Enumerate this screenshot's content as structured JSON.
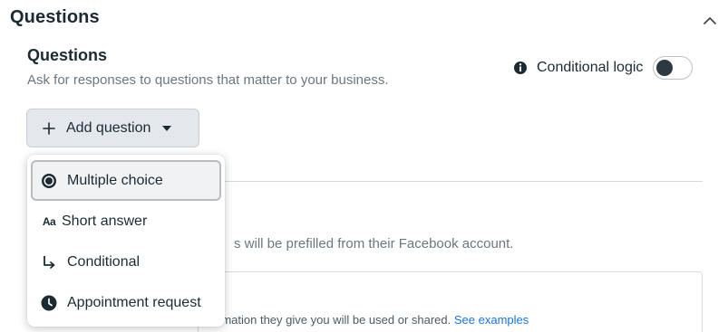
{
  "section": {
    "title": "Questions",
    "collapse_icon": "chevron-up-icon"
  },
  "questions": {
    "title": "Questions",
    "description": "Ask for responses to questions that matter to your business."
  },
  "conditional_logic": {
    "label": "Conditional logic",
    "enabled": false
  },
  "add_question": {
    "label": "Add question"
  },
  "dropdown": {
    "items": [
      {
        "label": "Multiple choice",
        "icon": "radio-icon",
        "selected": true
      },
      {
        "label": "Short answer",
        "icon": "text-aa-icon",
        "glyph": "Aa",
        "selected": false
      },
      {
        "label": "Conditional",
        "icon": "conditional-arrow-icon",
        "selected": false
      },
      {
        "label": "Appointment request",
        "icon": "clock-icon",
        "selected": false
      }
    ]
  },
  "background": {
    "prefill_text": "s will be prefilled from their Facebook account.",
    "info_text": "rmation they give you will be used or shared.",
    "see_examples": "See examples"
  },
  "colors": {
    "link": "#1a74e4",
    "toggle_knob": "#2b3942",
    "button_bg": "#e4e7eb"
  }
}
